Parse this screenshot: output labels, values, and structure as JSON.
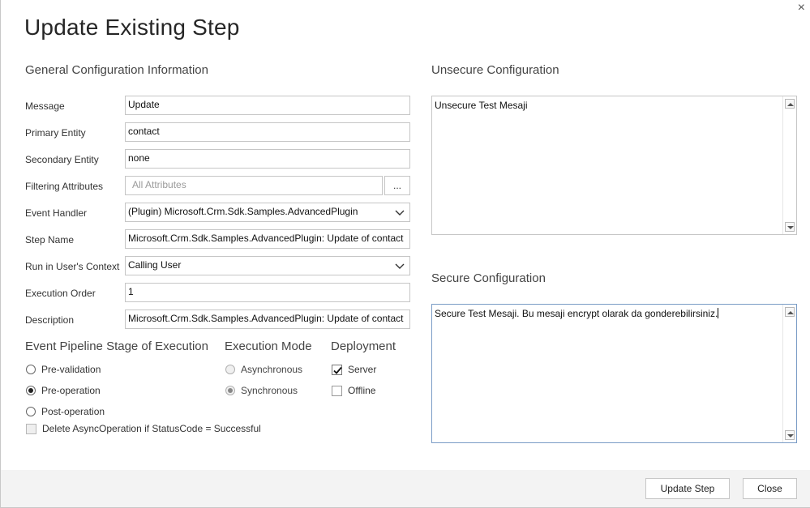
{
  "dialog": {
    "title": "Update Existing Step",
    "close_symbol": "×"
  },
  "general": {
    "section_title": "General Configuration Information",
    "fields": {
      "message": {
        "label": "Message",
        "value": "Update"
      },
      "primary_entity": {
        "label": "Primary Entity",
        "value": "contact"
      },
      "secondary_entity": {
        "label": "Secondary Entity",
        "value": "none"
      },
      "filtering_attributes": {
        "label": "Filtering Attributes",
        "placeholder": "All Attributes",
        "button_label": "..."
      },
      "event_handler": {
        "label": "Event Handler",
        "value": "(Plugin) Microsoft.Crm.Sdk.Samples.AdvancedPlugin"
      },
      "step_name": {
        "label": "Step Name",
        "value": "Microsoft.Crm.Sdk.Samples.AdvancedPlugin: Update of contact"
      },
      "run_context": {
        "label": "Run in User's Context",
        "value": "Calling User"
      },
      "execution_order": {
        "label": "Execution Order",
        "value": "1"
      },
      "description": {
        "label": "Description",
        "value": "Microsoft.Crm.Sdk.Samples.AdvancedPlugin: Update of contact"
      }
    }
  },
  "pipeline": {
    "title": "Event Pipeline Stage of Execution",
    "options": [
      {
        "label": "Pre-validation",
        "checked": false
      },
      {
        "label": "Pre-operation",
        "checked": true
      },
      {
        "label": "Post-operation",
        "checked": false
      }
    ],
    "delete_async_label": "Delete AsyncOperation if StatusCode = Successful"
  },
  "execution_mode": {
    "title": "Execution Mode",
    "options": [
      {
        "label": "Asynchronous",
        "checked": false
      },
      {
        "label": "Synchronous",
        "checked": true
      }
    ]
  },
  "deployment": {
    "title": "Deployment",
    "options": [
      {
        "label": "Server",
        "checked": true
      },
      {
        "label": "Offline",
        "checked": false
      }
    ]
  },
  "unsecure": {
    "title": "Unsecure  Configuration",
    "value": "Unsecure Test Mesaji"
  },
  "secure": {
    "title": "Secure  Configuration",
    "value": "Secure Test Mesaji. Bu mesaji encrypt olarak da gonderebilirsiniz."
  },
  "footer": {
    "update_button": "Update Step",
    "close_button": "Close"
  },
  "colors": {
    "footer_bg": "#f3f3f3",
    "border": "#c6c6c6",
    "focus_border": "#7a9cc6"
  }
}
